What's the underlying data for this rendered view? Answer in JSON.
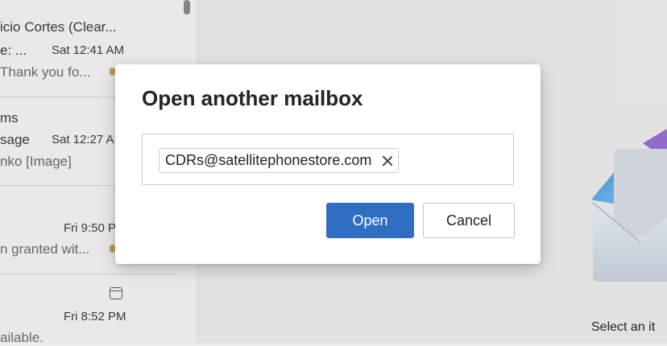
{
  "mail_list": {
    "items": [
      {
        "sender": "icio Cortes (Clear...",
        "subject": "e: ...",
        "time": "Sat 12:41 AM",
        "preview": "Thank you fo..."
      },
      {
        "sender": "ms",
        "subject": "sage",
        "time": "Sat 12:27 A",
        "preview": "nko [Image]"
      },
      {
        "sender": "",
        "subject": "",
        "time": "Fri 9:50 P",
        "preview": "n granted wit..."
      },
      {
        "sender": "",
        "subject": "",
        "time": "Fri 8:52 PM",
        "preview": "ailable."
      }
    ]
  },
  "reading_pane": {
    "empty_text": "Select an it",
    "illustration": "envelope-illustration"
  },
  "dialog": {
    "title": "Open another mailbox",
    "recipient_chip": "CDRs@satellitephonestore.com",
    "remove_icon": "dismiss-icon",
    "open_label": "Open",
    "cancel_label": "Cancel"
  },
  "colors": {
    "primary": "#2f6ec0",
    "dialog_bg": "#ffffff",
    "backdrop": "#ececec"
  }
}
